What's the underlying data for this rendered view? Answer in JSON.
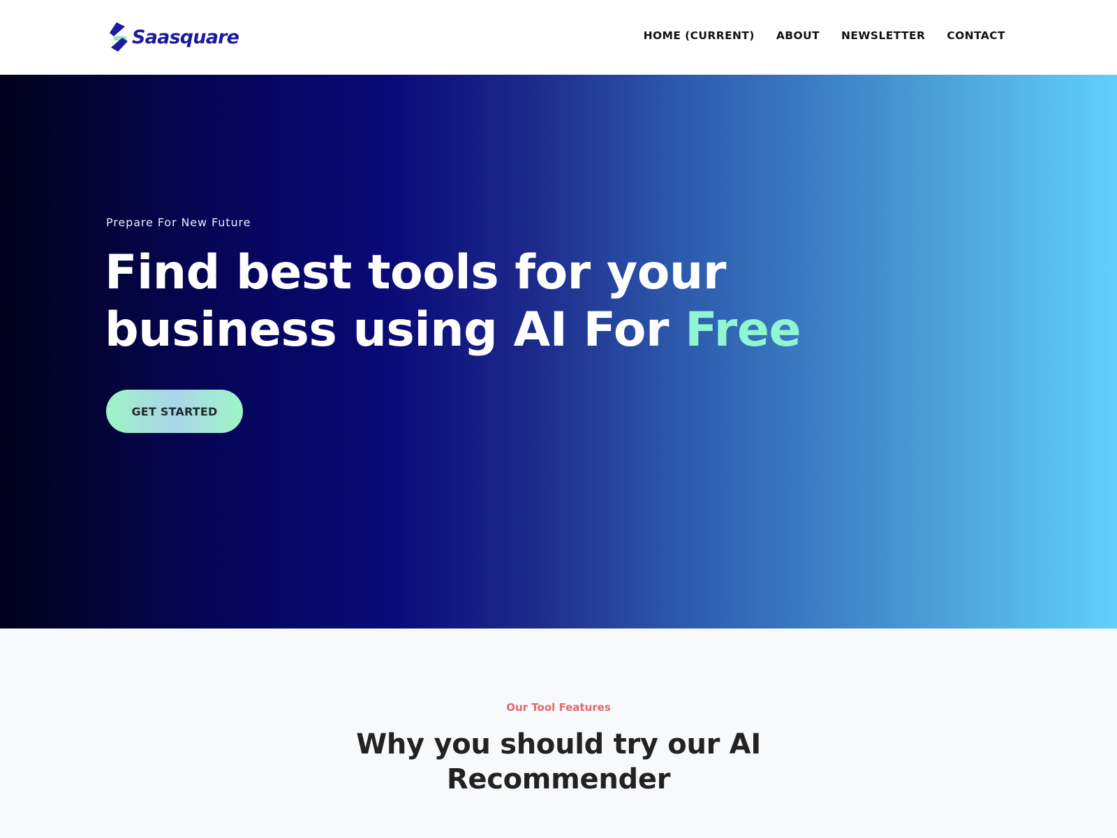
{
  "header": {
    "logo": {
      "text": "Saasquare",
      "icon": "saasquare-logo-icon"
    },
    "nav": [
      {
        "label": "HOME (CURRENT)",
        "current": true
      },
      {
        "label": "ABOUT"
      },
      {
        "label": "NEWSLETTER"
      },
      {
        "label": "CONTACT"
      }
    ]
  },
  "hero": {
    "subtitle": "Prepare For New Future",
    "title_line1": "Find best tools for your",
    "title_line2": "business using AI For ",
    "title_accent": "Free",
    "cta_label": "GET STARTED",
    "colors": {
      "gradient_start": "#02021c",
      "gradient_mid": "#0a0a78",
      "gradient_end": "#60d0fa",
      "accent": "#92f5d2"
    }
  },
  "features": {
    "kicker": "Our Tool Features",
    "title": "Why you should try our AI Recommender",
    "colors": {
      "kicker": "#e06a6a"
    }
  }
}
